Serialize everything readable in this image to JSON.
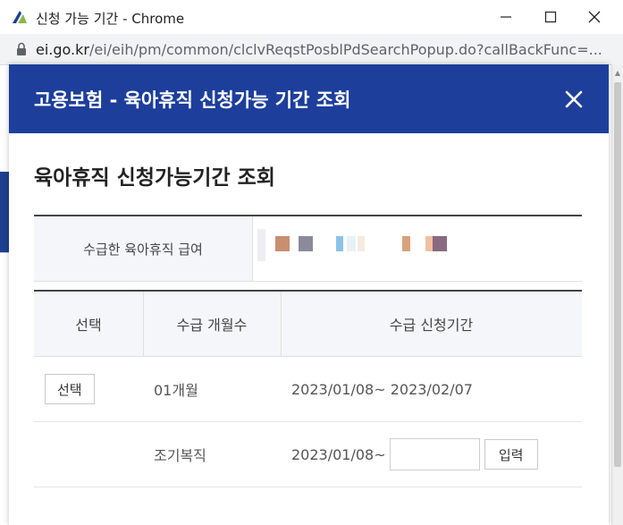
{
  "window": {
    "title": "신청 가능 기간 - Chrome",
    "controls": [
      "minimize-icon",
      "maximize-icon",
      "close-icon"
    ]
  },
  "address_bar": {
    "host": "ei.go.kr",
    "path": "/ei/eih/pm/common/clclvReqstPosblPdSearchPopup.do?callBackFunc=..."
  },
  "modal": {
    "header_title": "고용보험 - 육아휴직 신청가능 기간 조회",
    "section_title": "육아휴직 신청가능기간 조회",
    "info": {
      "label": "수급한 육아휴직 급여"
    },
    "table": {
      "headers": [
        "선택",
        "수급 개월수",
        "수급 신청기간"
      ],
      "rows": [
        {
          "select_label": "선택",
          "months": "01개월",
          "period": "2023/01/08~ 2023/02/07"
        },
        {
          "months": "조기복직",
          "period_start": "2023/01/08~",
          "end_date_value": "",
          "input_button": "입력"
        }
      ]
    }
  },
  "colors": {
    "header_blue": "#1d3f9b",
    "table_head_bg": "#f5f6f9"
  }
}
